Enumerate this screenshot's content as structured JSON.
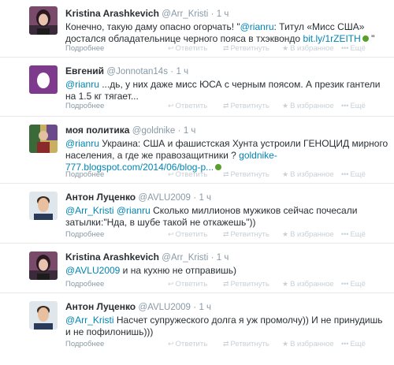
{
  "footer_labels": {
    "more": "Подробнее",
    "reply": "Ответить",
    "retweet": "Ретвитнуть",
    "favorite": "В избранное",
    "more_actions": "Ещё"
  },
  "tweets": [
    {
      "fullname": "Kristina Arashkevich",
      "username": "@Arr_Kristi",
      "sep": "·",
      "time": "1 ч",
      "line1_a": "Конечно, такую даму опасно огорчать! \"",
      "line1_mention": "@rianru",
      "line1_b": ": Титул «Мисс США»",
      "line2_a": "достался обладательнице черного пояса в тхэквондо ",
      "line2_link": "bit.ly/1rZEITH",
      "line2_b": " \""
    },
    {
      "fullname": "Евгений",
      "username": "@Jonnotan14s",
      "sep": "·",
      "time": "1 ч",
      "line1_mention": "@rianru",
      "line1_b": " ...дь, у них даже мисс ЮСА с черным поясом. А презик гантели",
      "line2_a": "на 1.5 кг тягает..."
    },
    {
      "fullname": "моя политика",
      "username": "@goldnike",
      "sep": "·",
      "time": "1 ч",
      "line1_mention": "@rianru",
      "line1_b": " Украина: США и фашистская Хунта устроили ГЕНОЦИД мирного",
      "line2_a": "населения, а где же правозащитники ? ",
      "line2_link": "goldnike-",
      "line3_link": "777.blogspot.com/2014/06/blog-p..."
    },
    {
      "fullname": "Антон Луценко",
      "username": "@AVLU2009",
      "sep": "·",
      "time": "1 ч",
      "line1_mention": "@Arr_Kristi",
      "line1_mention2": "@rianru",
      "line1_b": " Сколько миллионов мужиков сейчас почесали",
      "line2_a": "затылки:\"Нда, в шубе такой не откажешь\"))"
    },
    {
      "fullname": "Kristina Arashkevich",
      "username": "@Arr_Kristi",
      "sep": "·",
      "time": "1 ч",
      "line1_mention": "@AVLU2009",
      "line1_b": " и на кухню не отправишь)"
    },
    {
      "fullname": "Антон Луценко",
      "username": "@AVLU2009",
      "sep": "·",
      "time": "1 ч",
      "line1_mention": "@Arr_Kristi",
      "line1_b": " Насчет супружеского долга я уж промолчу)) И не принудишь",
      "line2_a": "и не пофилонишь)))"
    }
  ]
}
